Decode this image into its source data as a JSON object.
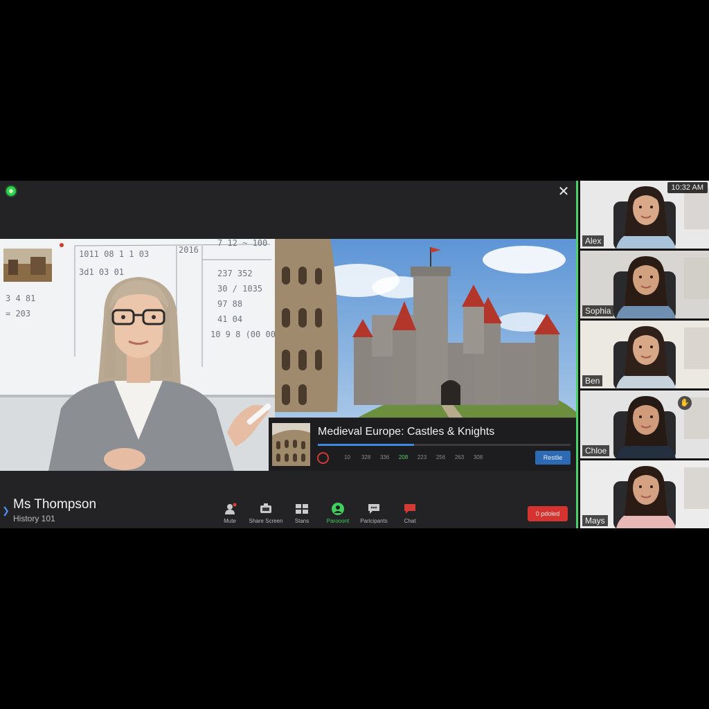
{
  "main": {
    "close_label": "✕",
    "presenter": {
      "name": "Ms Thompson",
      "subtitle": "History 101"
    },
    "slide": {
      "title": "Medieval Europe: Castles & Knights",
      "progress": 0.38,
      "timeline": [
        "10",
        "328",
        "336",
        "208",
        "223",
        "256",
        "263",
        "308"
      ],
      "timeline_active_index": 3,
      "action_label": "Restlie"
    },
    "toolbar": [
      {
        "id": "mute",
        "label": "Mute",
        "icon": "mic-icon",
        "active": false
      },
      {
        "id": "share",
        "label": "Share Screen",
        "icon": "share-screen-icon",
        "active": false
      },
      {
        "id": "stats",
        "label": "Stans",
        "icon": "grid-icon",
        "active": false
      },
      {
        "id": "present",
        "label": "Parooont",
        "icon": "person-icon",
        "active": true
      },
      {
        "id": "participants",
        "label": "Paricipants",
        "icon": "chat-bubble-icon",
        "active": false
      },
      {
        "id": "chat",
        "label": "Chat",
        "icon": "chat-icon",
        "active": false
      }
    ],
    "end_label": "0 pdoled",
    "whiteboard_text": [
      "2016",
      "7 12 ~ 100",
      "1011 08 1 1 03",
      "237 352",
      "3 4 81",
      "30 / 1035",
      "3d1 03 01",
      "97 88",
      "= 203",
      "41 04",
      "10 9 8 (00 00)"
    ]
  },
  "participants": {
    "clock": "10:32 AM",
    "tiles": [
      {
        "name": "Alex"
      },
      {
        "name": "Sophia"
      },
      {
        "name": "Ben"
      },
      {
        "name": "Chloe",
        "hand_raised": true
      },
      {
        "name": "Mays"
      }
    ]
  },
  "colors": {
    "accent_green": "#48d467",
    "accent_blue": "#2c6bb3",
    "end_red": "#d5332f"
  }
}
